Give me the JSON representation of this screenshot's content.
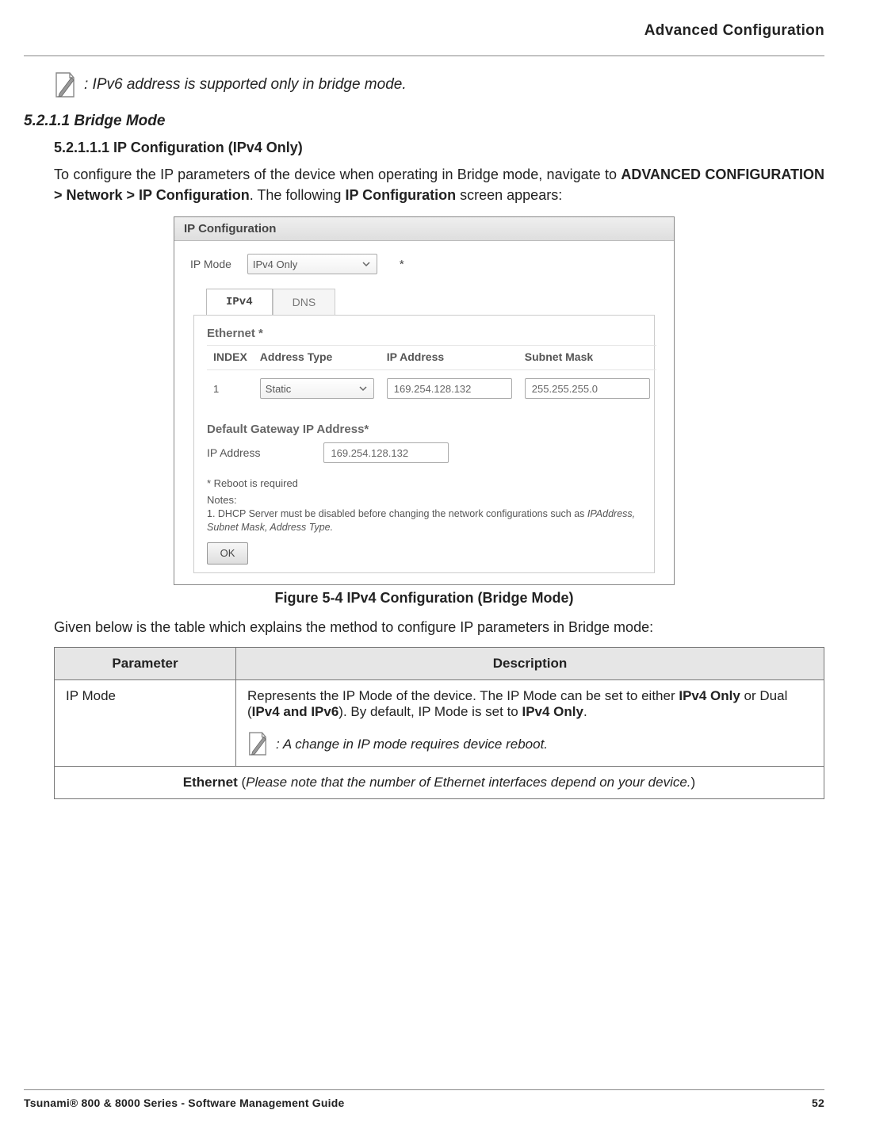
{
  "header": {
    "title": "Advanced Configuration"
  },
  "top_note": {
    "text": ": IPv6 address is supported only in bridge mode."
  },
  "sections": {
    "bridge_mode_title": "5.2.1.1 Bridge Mode",
    "ip_config_title": "5.2.1.1.1 IP Configuration (IPv4 Only)",
    "intro_pre": "To configure the IP parameters of the device when operating in Bridge mode, navigate to ",
    "intro_bold": "ADVANCED CONFIGURATION > Network > IP Configuration",
    "intro_mid": ". The following ",
    "intro_bold2": "IP Configuration",
    "intro_post": " screen appears:"
  },
  "figure": {
    "panel_title": "IP Configuration",
    "ip_mode_label": "IP Mode",
    "ip_mode_value": "IPv4 Only",
    "req_mark": "*",
    "tabs": {
      "ipv4": "IPv4",
      "dns": "DNS"
    },
    "eth_label": "Ethernet *",
    "eth_headers": {
      "index": "INDEX",
      "addr_type": "Address Type",
      "ip": "IP Address",
      "mask": "Subnet Mask"
    },
    "eth_row": {
      "index": "1",
      "addr_type": "Static",
      "ip": "169.254.128.132",
      "mask": "255.255.255.0"
    },
    "gw_label": "Default Gateway IP Address*",
    "gw_ip_label": "IP Address",
    "gw_ip_value": "169.254.128.132",
    "reboot_note": "* Reboot is required",
    "notes_h": "Notes:",
    "notes_line_pre": "1. DHCP Server must be disabled before changing the network configurations such as ",
    "notes_line_it": "IPAddress, Subnet Mask, Address Type.",
    "ok_label": "OK",
    "caption": "Figure 5-4 IPv4 Configuration (Bridge Mode)"
  },
  "after_fig": "Given below is the table which explains the method to configure IP parameters in Bridge mode:",
  "params": {
    "head_param": "Parameter",
    "head_desc": "Description",
    "row1_param": "IP Mode",
    "row1_desc_pre": "Represents the IP Mode of the device. The IP Mode can be set to either ",
    "row1_desc_b1": "IPv4 Only",
    "row1_desc_mid1": " or Dual (",
    "row1_desc_b2": "IPv4 and IPv6",
    "row1_desc_mid2": "). By default, IP Mode is set to ",
    "row1_desc_b3": "IPv4 Only",
    "row1_desc_end": ".",
    "row1_note": ": A change in IP mode requires device reboot.",
    "eth_section_b": "Ethernet",
    "eth_section_open": " (",
    "eth_section_it": "Please note that the number of Ethernet interfaces depend on your device.",
    "eth_section_close": ")"
  },
  "footer": {
    "left": "Tsunami® 800 & 8000 Series - Software Management Guide",
    "page": "52"
  },
  "chart_data": {
    "type": "table",
    "title": "IP Configuration (Bridge Mode) Parameters",
    "columns": [
      "Parameter",
      "Description"
    ],
    "rows": [
      [
        "IP Mode",
        "Represents the IP Mode of the device. The IP Mode can be set to either IPv4 Only or Dual (IPv4 and IPv6). By default, IP Mode is set to IPv4 Only. A change in IP mode requires device reboot."
      ],
      [
        "Ethernet",
        "Please note that the number of Ethernet interfaces depend on your device."
      ]
    ],
    "ethernet_config": {
      "columns": [
        "INDEX",
        "Address Type",
        "IP Address",
        "Subnet Mask"
      ],
      "rows": [
        [
          "1",
          "Static",
          "169.254.128.132",
          "255.255.255.0"
        ]
      ],
      "default_gateway_ip": "169.254.128.132",
      "ip_mode": "IPv4 Only"
    }
  }
}
